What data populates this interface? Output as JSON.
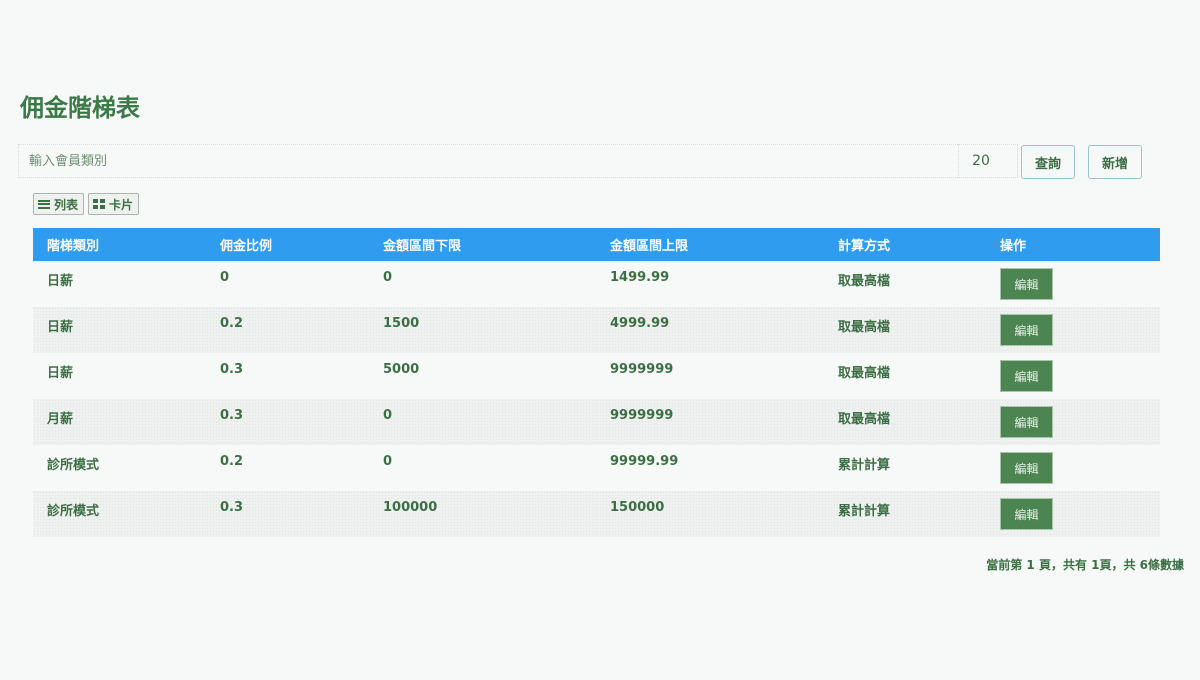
{
  "page": {
    "title": "佣金階梯表"
  },
  "search": {
    "placeholder": "輸入會員類別",
    "page_size": "20"
  },
  "buttons": {
    "query": "查詢",
    "add": "新增",
    "edit": "編輯"
  },
  "view": {
    "list_label": "列表",
    "card_label": "卡片"
  },
  "table": {
    "headers": [
      "階梯類別",
      "佣金比例",
      "金額區間下限",
      "金額區間上限",
      "計算方式",
      "操作"
    ],
    "rows": [
      [
        "日薪",
        "0",
        "0",
        "1499.99",
        "取最高檔"
      ],
      [
        "日薪",
        "0.2",
        "1500",
        "4999.99",
        "取最高檔"
      ],
      [
        "日薪",
        "0.3",
        "5000",
        "9999999",
        "取最高檔"
      ],
      [
        "月薪",
        "0.3",
        "0",
        "9999999",
        "取最高檔"
      ],
      [
        "診所模式",
        "0.2",
        "0",
        "99999.99",
        "累計計算"
      ],
      [
        "診所模式",
        "0.3",
        "100000",
        "150000",
        "累計計算"
      ]
    ]
  },
  "pagination": {
    "text": "當前第 1 頁，共有 1頁，共 6條數據"
  },
  "colors": {
    "header_bg": "#2f9cf0",
    "edit_button": "#4c8552",
    "title": "#3b7a47"
  }
}
